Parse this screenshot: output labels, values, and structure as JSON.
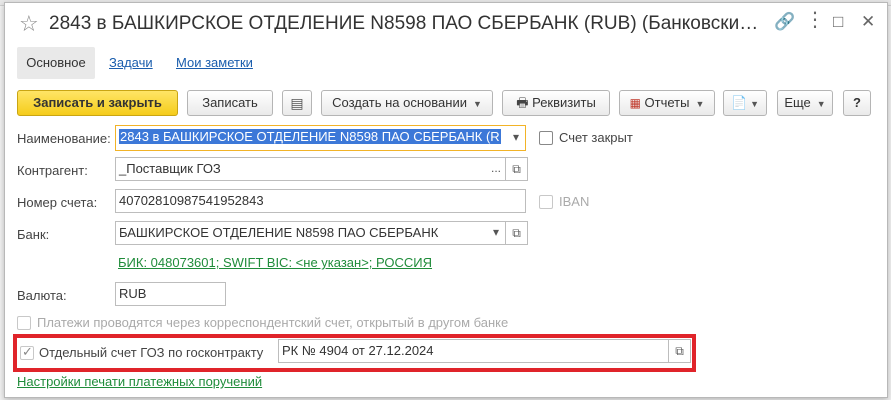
{
  "window": {
    "title": "2843 в БАШКИРСКОЕ ОТДЕЛЕНИЕ N8598 ПАО СБЕРБАНК (RUB) (Банковский ..."
  },
  "tabs": [
    {
      "label": "Основное",
      "active": true
    },
    {
      "label": "Задачи"
    },
    {
      "label": "Мои заметки"
    }
  ],
  "toolbar": {
    "save_close": "Записать и закрыть",
    "save": "Записать",
    "create_based": "Создать на основании",
    "requisites": "Реквизиты",
    "reports": "Отчеты",
    "more": "Еще",
    "help": "?"
  },
  "form": {
    "name": {
      "label": "Наименование:",
      "value": "2843 в БАШКИРСКОЕ ОТДЕЛЕНИЕ N8598 ПАО СБЕРБАНК (R"
    },
    "account_closed": {
      "label": "Счет закрыт",
      "checked": false
    },
    "counterparty": {
      "label": "Контрагент:",
      "value": "_Поставщик ГОЗ"
    },
    "account_number": {
      "label": "Номер счета:",
      "value": "40702810987541952843"
    },
    "iban": {
      "label": "IBAN",
      "checked": false
    },
    "bank": {
      "label": "Банк:",
      "value": "БАШКИРСКОЕ ОТДЕЛЕНИЕ N8598 ПАО СБЕРБАНК"
    },
    "bank_info_link": "БИК: 048073601; SWIFT BIC: <не указан>; РОССИЯ",
    "currency": {
      "label": "Валюта:",
      "value": "RUB"
    },
    "correspondent": {
      "label": "Платежи проводятся через корреспондентский счет, открытый в другом банке",
      "checked": false
    },
    "goz": {
      "label": "Отдельный счет ГОЗ по госконтракту",
      "checked": true,
      "value": "РК № 4904 от 27.12.2024"
    },
    "print_settings_link": "Настройки печати платежных поручений"
  },
  "colors": {
    "primary_button": "#f5cc1a",
    "highlight_frame": "#e0242a",
    "link_green": "#1f8c3a",
    "link_blue": "#1a5dad"
  }
}
